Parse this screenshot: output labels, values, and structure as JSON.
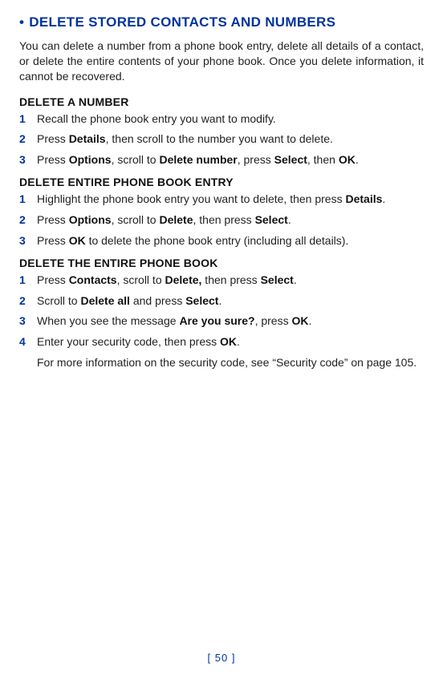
{
  "title": "DELETE STORED CONTACTS AND NUMBERS",
  "intro": "You can delete a number from a phone book entry, delete all details of a contact, or delete the entire contents of your phone book. Once you delete information, it cannot be recovered.",
  "section1": {
    "heading": "DELETE A NUMBER",
    "s1": {
      "num": "1",
      "pre": "Recall the phone book entry you want to modify."
    },
    "s2": {
      "num": "2",
      "pre": "Press ",
      "b1": "Details",
      "post": ", then scroll to the number you want to delete."
    },
    "s3": {
      "num": "3",
      "pre": "Press ",
      "b1": "Options",
      "mid1": ", scroll to ",
      "b2": "Delete number",
      "mid2": ", press ",
      "b3": "Select",
      "mid3": ", then ",
      "b4": "OK",
      "post": "."
    }
  },
  "section2": {
    "heading": "DELETE ENTIRE PHONE BOOK ENTRY",
    "s1": {
      "num": "1",
      "pre": "Highlight the phone book entry you want to delete, then press ",
      "b1": "Details",
      "post": "."
    },
    "s2": {
      "num": "2",
      "pre": "Press ",
      "b1": "Options",
      "mid1": ", scroll to ",
      "b2": "Delete",
      "mid2": ", then press ",
      "b3": "Select",
      "post": "."
    },
    "s3": {
      "num": "3",
      "pre": "Press ",
      "b1": "OK",
      "post": " to delete the phone book entry (including all details)."
    }
  },
  "section3": {
    "heading": "DELETE THE ENTIRE PHONE BOOK",
    "s1": {
      "num": "1",
      "pre": "Press ",
      "b1": "Contacts",
      "mid1": ", scroll to ",
      "b2": "Delete,",
      "mid2": " then press ",
      "b3": "Select",
      "post": "."
    },
    "s2": {
      "num": "2",
      "pre": "Scroll to ",
      "b1": "Delete all",
      "mid1": " and press ",
      "b2": "Select",
      "post": "."
    },
    "s3": {
      "num": "3",
      "pre": "When you see the message ",
      "b1": "Are you sure?",
      "mid1": ", press ",
      "b2": "OK",
      "post": "."
    },
    "s4": {
      "num": "4",
      "pre": "Enter your security code, then press ",
      "b1": "OK",
      "post": "."
    },
    "note": "For more information on the security code, see “Security code” on page 105."
  },
  "pageNumber": "[ 50 ]"
}
